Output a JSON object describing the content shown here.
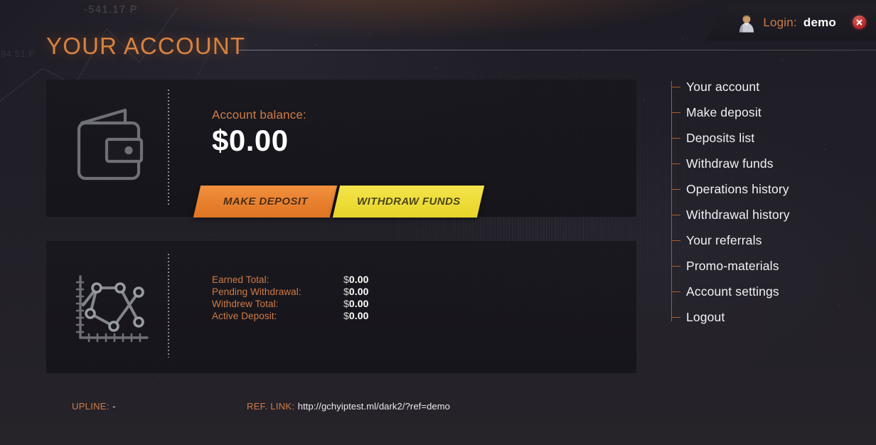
{
  "header": {
    "login_label": "Login:",
    "login_user": "demo",
    "avatar_icon": "user-avatar-icon",
    "close_icon": "close-icon"
  },
  "page": {
    "title": "YOUR ACCOUNT",
    "background_ghost_number": "-541.17 P",
    "background_ghost_number_2": "-94 51 P"
  },
  "balance_panel": {
    "icon": "wallet-icon",
    "label": "Account balance:",
    "value": "$0.00"
  },
  "actions": {
    "deposit_label": "MAKE DEPOSIT",
    "withdraw_label": "WITHDRAW FUNDS"
  },
  "stats_panel": {
    "icon": "line-chart-icon",
    "rows": [
      {
        "label": "Earned Total:",
        "value": "0.00",
        "currency": "$"
      },
      {
        "label": "Pending Withdrawal:",
        "value": "0.00",
        "currency": "$"
      },
      {
        "label": "Withdrew Total:",
        "value": "0.00",
        "currency": "$"
      },
      {
        "label": "Active Deposit:",
        "value": "0.00",
        "currency": "$"
      }
    ]
  },
  "sidebar": {
    "items": [
      {
        "label": "Your account"
      },
      {
        "label": "Make deposit"
      },
      {
        "label": "Deposits list"
      },
      {
        "label": "Withdraw funds"
      },
      {
        "label": "Operations history"
      },
      {
        "label": "Withdrawal history"
      },
      {
        "label": "Your referrals"
      },
      {
        "label": "Promo-materials"
      },
      {
        "label": "Account settings"
      },
      {
        "label": "Logout"
      }
    ]
  },
  "footer": {
    "upline_key": "UPLINE:",
    "upline_value": "-",
    "reflink_key": "REF. LINK:",
    "reflink_value": "http://gchyiptest.ml/dark2/?ref=demo"
  },
  "colors": {
    "accent_orange": "#d9813f",
    "label_orange": "#cf7b46",
    "button_orange": "#e8802e",
    "button_yellow": "#eedc38",
    "rail_orange": "#a75f2c",
    "page_bg": "#211f27",
    "panel_bg": "#17161c",
    "close_red": "#b32222"
  }
}
